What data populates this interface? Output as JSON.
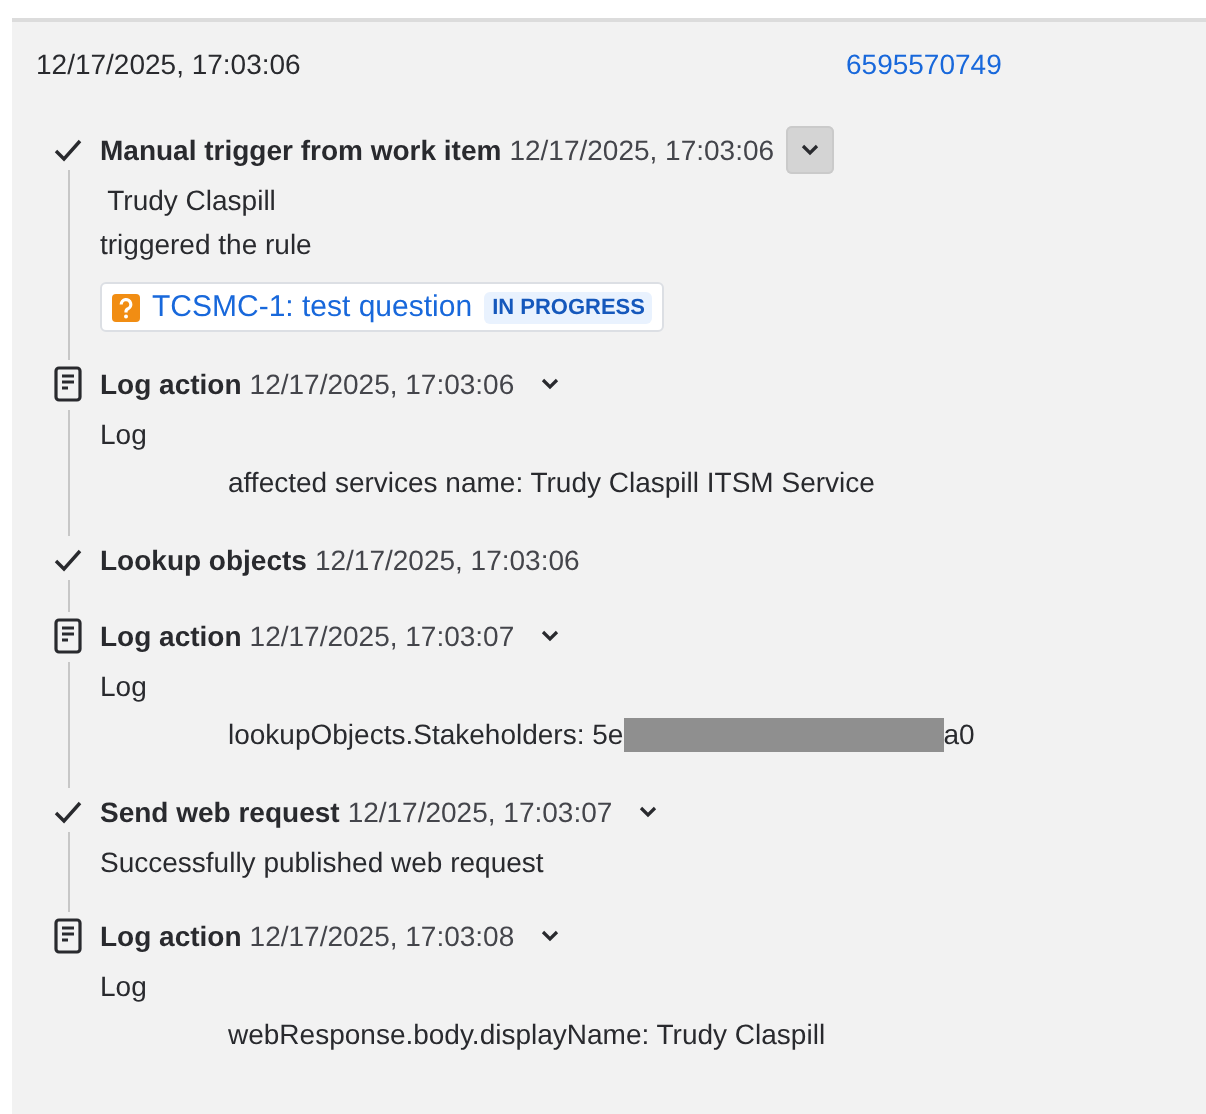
{
  "summary": {
    "time": "12/17/2025, 17:03:06",
    "id": "6595570749"
  },
  "steps": [
    {
      "kind": "check",
      "title": "Manual trigger from work item",
      "time": "12/17/2025, 17:03:06",
      "collapsible": true,
      "highlighted": true,
      "lines": [
        {
          "kind": "text",
          "text": " Trudy Claspill"
        },
        {
          "kind": "text",
          "text": "triggered the rule"
        },
        {
          "kind": "issue",
          "key": "TCSMC-1: test question",
          "status": "IN PROGRESS"
        }
      ]
    },
    {
      "kind": "log",
      "title": "Log action",
      "time": "12/17/2025, 17:03:06",
      "collapsible": true,
      "highlighted": false,
      "lines": [
        {
          "kind": "text",
          "text": "Log"
        },
        {
          "kind": "entry",
          "text": "affected services name: Trudy Claspill ITSM Service"
        }
      ]
    },
    {
      "kind": "check",
      "title": "Lookup objects",
      "time": "12/17/2025, 17:03:06",
      "collapsible": false
    },
    {
      "kind": "log",
      "title": "Log action",
      "time": "12/17/2025, 17:03:07",
      "collapsible": true,
      "highlighted": false,
      "lines": [
        {
          "kind": "text",
          "text": "Log"
        },
        {
          "kind": "entry",
          "text": "lookupObjects.Stakeholders: 5e",
          "redacted": true,
          "suffix": "a0"
        }
      ]
    },
    {
      "kind": "check",
      "title": "Send web request",
      "time": "12/17/2025, 17:03:07",
      "collapsible": true,
      "highlighted": false,
      "lines": [
        {
          "kind": "text",
          "text": "Successfully published web request"
        }
      ]
    },
    {
      "kind": "log",
      "title": "Log action",
      "time": "12/17/2025, 17:03:08",
      "collapsible": true,
      "highlighted": false,
      "lines": [
        {
          "kind": "text",
          "text": "Log"
        },
        {
          "kind": "entry",
          "text": "webResponse.body.displayName: Trudy Claspill"
        }
      ]
    }
  ]
}
